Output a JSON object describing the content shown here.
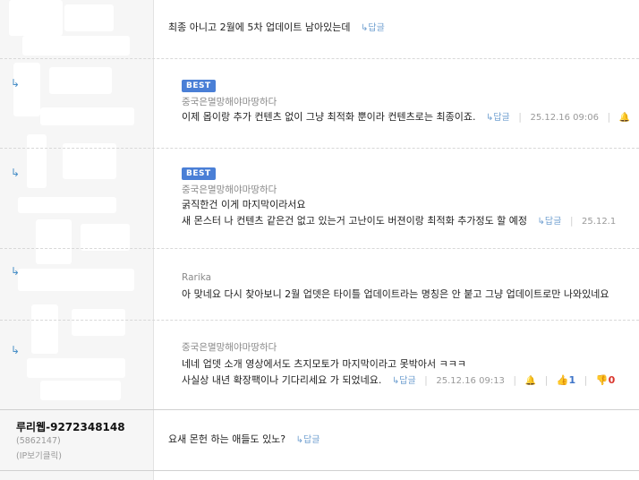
{
  "comments": [
    {
      "text": "최종 아니고 2월에 5차 업데이트 남아있는데",
      "reply_label": "↳답글"
    },
    {
      "badge": "BEST",
      "nickname": "중국은멸망해야마땅하다",
      "text": "이제 몹이랑 추가 컨텐츠 없이 그냥 최적화 뿐이라 컨텐츠로는 최종이죠.",
      "reply_label": "↳답글",
      "date": "25.12.16 09:06"
    },
    {
      "badge": "BEST",
      "nickname": "중국은멸망해야마땅하다",
      "text_line1": "굵직한건 이게 마지막이라서요",
      "text_line2": "새 몬스터 나 컨텐츠 같은건 없고 있는거 고난이도 버젼이랑 최적화 추가정도 할 예정",
      "reply_label": "↳답글",
      "date": "25.12.1"
    },
    {
      "nickname": "Rarika",
      "text": "아 맞네요 다시 찾아보니 2월 업뎃은 타이틀 업데이트라는 명칭은 안 붙고 그냥 업데이트로만 나와있네요"
    },
    {
      "nickname": "중국은멸망해야마땅하다",
      "text_line1": "네네 업뎃 소개 영상에서도 츠지모토가 마지막이라고 못박아서 ㅋㅋㅋ",
      "text_line2": "사실상 내년 확장팩이나 기다리세요 가 되었네요.",
      "reply_label": "↳답글",
      "date": "25.12.16 09:13",
      "likes": "1",
      "dislikes": "0"
    },
    {
      "author": "루리웹-9272348148",
      "author_id": "(5862147)",
      "author_ip": "(IP보기클릭)",
      "text": "요새 몬헌 하는 애들도 있노?",
      "reply_label": "↳답글"
    }
  ],
  "icons": {
    "reply_arrow": "reply-arrow-icon",
    "bell": "report-bell-icon",
    "thumb_up": "thumb-up-icon",
    "thumb_down": "thumb-down-icon"
  },
  "colors": {
    "best_badge": "#4a7fd6",
    "reply_link": "#6f9fd0",
    "like": "#3e74c8",
    "dislike": "#d9342b"
  }
}
